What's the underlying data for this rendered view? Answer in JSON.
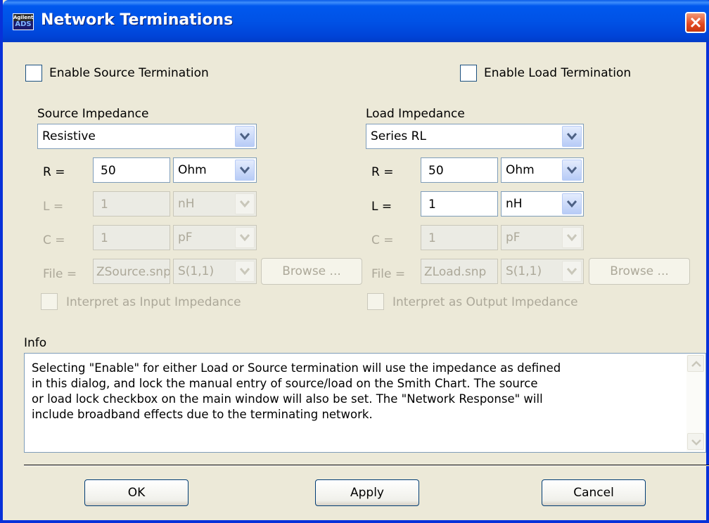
{
  "window": {
    "title": "Network Terminations",
    "app_icon": {
      "line1": "Agilent",
      "line2": "ADS"
    }
  },
  "source": {
    "enable_label": "Enable Source Termination",
    "enable_checked": false,
    "impedance_label": "Source Impedance",
    "impedance_type": "Resistive",
    "rows": {
      "r": {
        "label": "R =",
        "value": "50",
        "unit": "Ohm",
        "enabled": true
      },
      "l": {
        "label": "L =",
        "value": "1",
        "unit": "nH",
        "enabled": false
      },
      "c": {
        "label": "C =",
        "value": "1",
        "unit": "pF",
        "enabled": false
      },
      "file": {
        "label": "File =",
        "value": "ZSource.snp",
        "param": "S(1,1)",
        "enabled": false
      }
    },
    "browse_label": "Browse ...",
    "interpret_label": "Interpret as Input Impedance"
  },
  "load": {
    "enable_label": "Enable Load Termination",
    "enable_checked": false,
    "impedance_label": "Load Impedance",
    "impedance_type": "Series RL",
    "rows": {
      "r": {
        "label": "R =",
        "value": "50",
        "unit": "Ohm",
        "enabled": true
      },
      "l": {
        "label": "L =",
        "value": "1",
        "unit": "nH",
        "enabled": true
      },
      "c": {
        "label": "C =",
        "value": "1",
        "unit": "pF",
        "enabled": false
      },
      "file": {
        "label": "File =",
        "value": "ZLoad.snp",
        "param": "S(1,1)",
        "enabled": false
      }
    },
    "browse_label": "Browse ...",
    "interpret_label": "Interpret as Output Impedance"
  },
  "info": {
    "label": "Info",
    "text": "Selecting \"Enable\" for either Load or Source termination will use the impedance as defined\nin this dialog, and lock the manual entry of source/load on the Smith Chart.  The source\nor load lock checkbox on the main window will also be set. The \"Network Response\" will\ninclude broadband effects due to the terminating network."
  },
  "buttons": {
    "ok": "OK",
    "apply": "Apply",
    "cancel": "Cancel"
  },
  "colors": {
    "title_bar": "#0054e3",
    "dialog_bg": "#ece9d8",
    "close": "#e2461d"
  }
}
